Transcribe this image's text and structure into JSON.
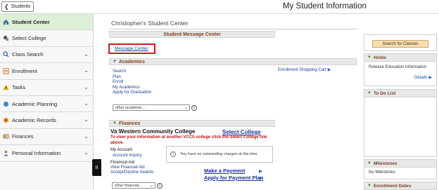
{
  "header": {
    "back_label": "Students",
    "title": "My Student Information"
  },
  "sidebar": {
    "items": [
      {
        "label": "Student Center",
        "icon": "home-icon"
      },
      {
        "label": "Select College",
        "icon": "pin-icon"
      },
      {
        "label": "Class Search",
        "icon": "search-icon"
      },
      {
        "label": "Enrollment",
        "icon": "enrollment-icon"
      },
      {
        "label": "Tasks",
        "icon": "warning-icon"
      },
      {
        "label": "Academic Planning",
        "icon": "globe-icon"
      },
      {
        "label": "Academic Records",
        "icon": "records-icon"
      },
      {
        "label": "Finances",
        "icon": "finances-icon"
      },
      {
        "label": "Personal Information",
        "icon": "person-icon"
      }
    ],
    "collapse_label": "II"
  },
  "main": {
    "title": "Christopher's Student Center",
    "message_center_header": "Student Message Center",
    "message_center_link": "Message Center",
    "academics": {
      "header": "Academics",
      "links": [
        "Search",
        "Plan",
        "Enroll",
        "My Academics",
        "Apply for Graduation"
      ],
      "shopping_cart": "Enrollment Shopping Cart",
      "select_value": "other academic...",
      "go": "»"
    },
    "finances": {
      "header": "Finances",
      "college_name": "Va Western Community College",
      "select_college": "Select College",
      "note": "To view your information at another VCCS college click the Select College link above.",
      "my_account_label": "My Account",
      "account_inquiry": "Account Inquiry",
      "financial_aid_label": "Financial Aid",
      "view_financial_aid": "View Financial Aid",
      "accept_decline": "Accept/Decline Awards",
      "charges_message": "You have no outstanding charges at this time.",
      "make_payment": "Make a Payment",
      "apply_payment_plan": "Apply for Payment Plan",
      "select_value": "other financial...",
      "go": "»"
    }
  },
  "right": {
    "search_classes": "Search for Classes",
    "holds": {
      "header": "Holds",
      "item": "Release Education Information",
      "details": "Details"
    },
    "todo": {
      "header": "To Do List"
    },
    "milestones": {
      "header": "Milestones",
      "item": "No Milestones"
    },
    "enrollment_dates": {
      "header": "Enrollment Dates"
    }
  },
  "colors": {
    "active_nav": "#ddefd6",
    "section_header_text": "#7a3e1e",
    "link": "#1c3f91",
    "highlight_border": "#d11a1a",
    "search_button": "#f8dcae"
  }
}
